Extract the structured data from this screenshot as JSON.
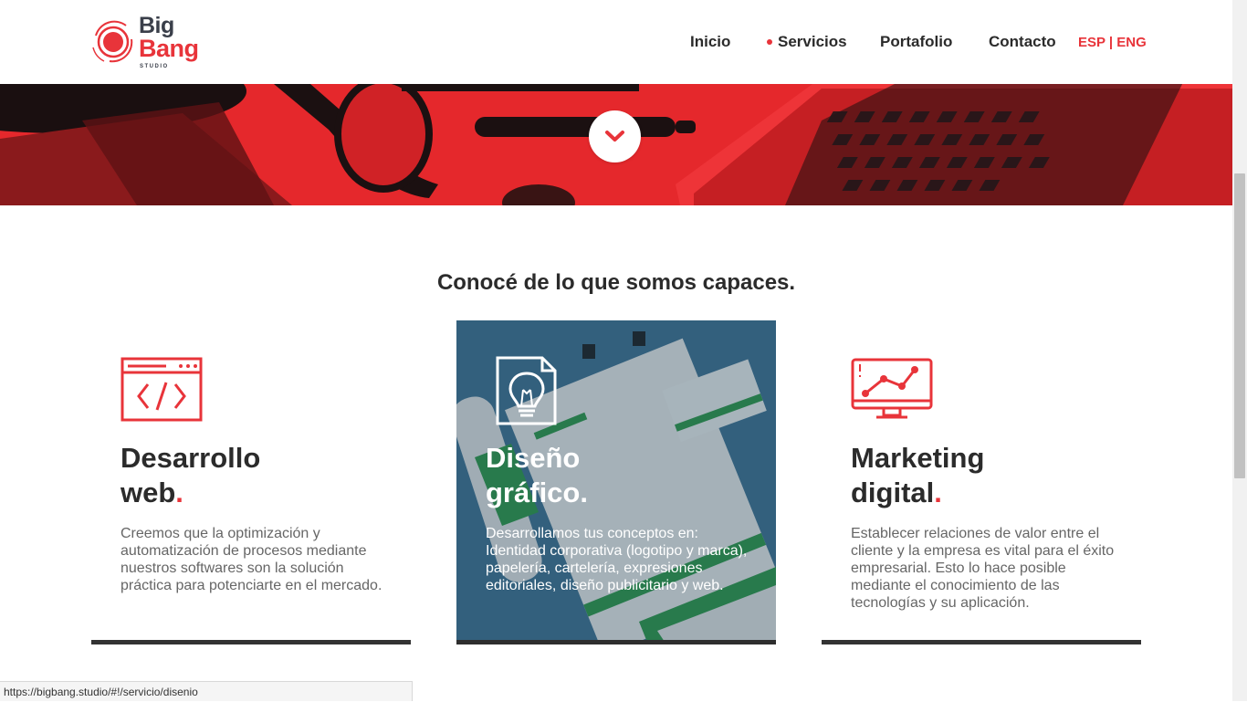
{
  "brand": {
    "name_line1": "Big",
    "name_line2": "Bang",
    "tagline": "STUDIO",
    "colors": {
      "accent": "#e8343a",
      "dark": "#2b2b2b",
      "active_card": "#3d6f8e"
    }
  },
  "nav": {
    "items": [
      {
        "label": "Inicio",
        "active": false
      },
      {
        "label": "Servicios",
        "active": true
      },
      {
        "label": "Portafolio",
        "active": false
      },
      {
        "label": "Contacto",
        "active": false
      }
    ],
    "lang_es": "ESP",
    "lang_sep": " | ",
    "lang_en": "ENG"
  },
  "hero": {
    "scroll_icon": "chevron-down-icon"
  },
  "services": {
    "title": "Conocé de lo que somos capaces.",
    "cards": [
      {
        "icon": "code-window-icon",
        "title_line1": "Desarrollo",
        "title_line2": "web",
        "title_dot": ".",
        "text": "Creemos que la optimización y automatización de procesos mediante nuestros softwares son la solución práctica para potenciarte en el mercado.",
        "active": false
      },
      {
        "icon": "lightbulb-document-icon",
        "title_line1": "Diseño",
        "title_line2": "gráfico",
        "title_dot": ".",
        "text": "Desarrollamos tus conceptos en: Identidad corporativa (logotipo y marca), papelería, cartelería, expresiones editoriales, diseño publicitario y web.",
        "active": true
      },
      {
        "icon": "monitor-chart-icon",
        "title_line1": "Marketing",
        "title_line2": "digital",
        "title_dot": ".",
        "text": "Establecer relaciones de valor entre el cliente y la empresa es vital para el éxito empresarial. Esto lo hace posible mediante el conocimiento de las tecnologías y su aplicación.",
        "active": false
      }
    ]
  },
  "status_bar": {
    "url": "https://bigbang.studio/#!/servicio/disenio"
  }
}
